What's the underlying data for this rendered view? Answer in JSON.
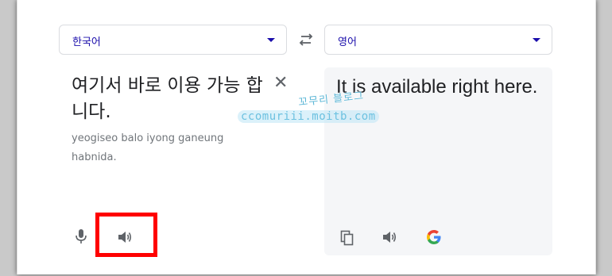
{
  "source_language": {
    "label": "한국어"
  },
  "target_language": {
    "label": "영어"
  },
  "source": {
    "text": "여기서 바로 이용 가능 합니다.",
    "romanization": "yeogiseo balo iyong ganeung habnida."
  },
  "target": {
    "text": "It is available right here."
  },
  "watermark": {
    "korean": "꼬무리 블로그",
    "english": "ccomuriii.moitb.com"
  },
  "colors": {
    "link_blue": "#1a0dab",
    "highlight_red": "#ff0000",
    "icon_gray": "#5f6368",
    "panel_bg": "#f5f6f8"
  },
  "icons": {
    "swap": "swap-arrows-icon",
    "clear": "close-icon",
    "mic": "microphone-icon",
    "speaker_source": "speaker-icon",
    "copy": "copy-icon",
    "speaker_target": "speaker-icon",
    "google": "google-logo-icon"
  }
}
